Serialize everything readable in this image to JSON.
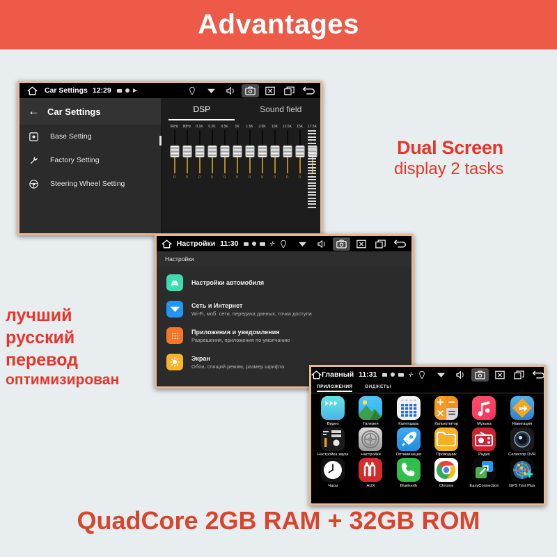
{
  "banner": {
    "title": "Advantages"
  },
  "callouts": {
    "dual_line1": "Dual Screen",
    "dual_line2": "display 2 tasks",
    "ru_line1": "лучший",
    "ru_line2": "русский",
    "ru_line3": "перевод",
    "ru_line4": "оптимизирован",
    "bottom": "QuadCore 2GB RAM + 32GB ROM"
  },
  "colors": {
    "banner_bg": "#ed5a47",
    "callout_red": "#e8352a",
    "bottom_red": "#d9452c",
    "frame": "#e8b894",
    "page_bg": "#e8edf0"
  },
  "screen1": {
    "statusbar": {
      "home_icon": "home-icon",
      "title": "Car Settings",
      "time": "12:29",
      "icons": [
        "sd-card-icon",
        "record-dot-icon",
        "play-triangle-icon"
      ],
      "right_icons": [
        "location-icon",
        "wifi-icon",
        "volume-icon",
        "screenshot-icon",
        "close-icon",
        "recents-icon",
        "back-icon"
      ]
    },
    "header": {
      "back_icon": "arrow-left-icon",
      "title": "Car Settings"
    },
    "menu": [
      {
        "icon": "base-setting-icon",
        "label": "Base Setting"
      },
      {
        "icon": "wrench-icon",
        "label": "Factory Setting"
      },
      {
        "icon": "steering-wheel-icon",
        "label": "Steering Wheel Setting"
      }
    ],
    "tabs": [
      {
        "label": "DSP",
        "selected": true
      },
      {
        "label": "Sound field",
        "selected": false
      }
    ],
    "equalizer": {
      "bands": [
        "60Hz",
        "80Hz",
        "0.1K",
        "0.2K",
        "0.5K",
        "1K",
        "1.5K",
        "2.5K",
        "10K",
        "12.5K",
        "15K",
        "17.5K"
      ],
      "values": [
        "0",
        "0",
        "0",
        "0",
        "0",
        "0",
        "0",
        "0",
        "0",
        "0",
        "0",
        "0"
      ]
    }
  },
  "screen2": {
    "statusbar": {
      "home_icon": "home-icon",
      "title": "Настройки",
      "time": "11:30",
      "icons": [
        "sd-card-icon",
        "record-dot-icon",
        "sim-icon",
        "bluetooth-icon"
      ],
      "right_icons": [
        "location-icon",
        "wifi-icon",
        "volume-icon",
        "screenshot-icon",
        "close-icon",
        "recents-icon",
        "back-icon"
      ]
    },
    "subheader": "Настройки",
    "items": [
      {
        "icon": "car-icon",
        "color": "#3ddcb0",
        "title": "Настройки автомобиля",
        "subtitle": ""
      },
      {
        "icon": "wifi-icon",
        "color": "#2196f3",
        "title": "Сеть и Интернет",
        "subtitle": "Wi-Fi, моб. сети, передача данных, точка доступа"
      },
      {
        "icon": "apps-grid-icon",
        "color": "#f4762a",
        "title": "Приложения и уведомления",
        "subtitle": "Разрешения, приложения по умолчанию"
      },
      {
        "icon": "brightness-icon",
        "color": "#f9b42a",
        "title": "Экран",
        "subtitle": "Обои, спящий режим, размер шрифта"
      }
    ]
  },
  "screen3": {
    "statusbar": {
      "home_icon": "home-icon",
      "title": "Главный",
      "time": "11:31",
      "icons": [
        "sd-card-icon",
        "record-dot-icon",
        "sim-icon",
        "bluetooth-icon"
      ],
      "right_icons": [
        "location-icon",
        "wifi-icon",
        "volume-icon",
        "screenshot-icon",
        "close-icon",
        "recents-icon",
        "back-icon"
      ]
    },
    "tabs": [
      {
        "label": "ПРИЛОЖЕНИЯ",
        "selected": true
      },
      {
        "label": "ВИДЖЕТЫ",
        "selected": false
      }
    ],
    "apps": [
      {
        "label": "Видео",
        "icon": "video-icon"
      },
      {
        "label": "Галерея",
        "icon": "gallery-icon"
      },
      {
        "label": "Календарь",
        "icon": "calendar-icon"
      },
      {
        "label": "Калькулятор",
        "icon": "calculator-icon"
      },
      {
        "label": "Музыка",
        "icon": "music-icon"
      },
      {
        "label": "Навигация",
        "icon": "navigation-icon"
      },
      {
        "label": "Настройка звука",
        "icon": "sound-settings-icon"
      },
      {
        "label": "Настройки",
        "icon": "settings-gear-icon"
      },
      {
        "label": "Оптимизация",
        "icon": "rocket-icon"
      },
      {
        "label": "Проводник",
        "icon": "folder-icon"
      },
      {
        "label": "Радио",
        "icon": "radio-icon"
      },
      {
        "label": "Селектор DVR",
        "icon": "camera-lens-icon"
      },
      {
        "label": "Часы",
        "icon": "clock-icon"
      },
      {
        "label": "AUX",
        "icon": "aux-cable-icon"
      },
      {
        "label": "Bluetooth",
        "icon": "phone-icon"
      },
      {
        "label": "Chrome",
        "icon": "chrome-icon"
      },
      {
        "label": "EasyConnection",
        "icon": "easyconnection-icon"
      },
      {
        "label": "GPS Test Plus",
        "icon": "gps-radar-icon"
      }
    ]
  }
}
